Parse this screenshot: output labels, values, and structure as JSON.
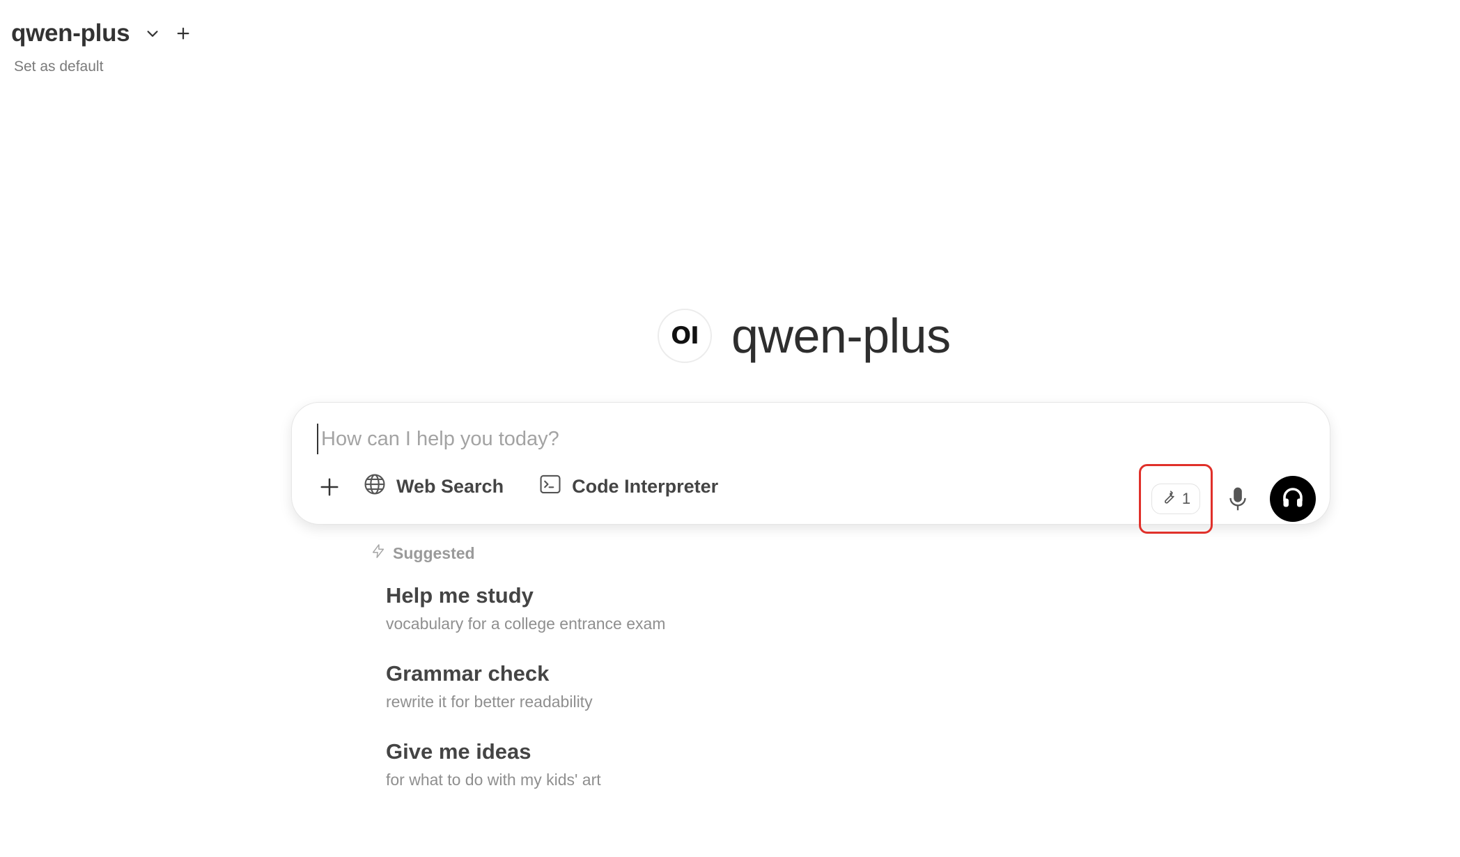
{
  "header": {
    "model_name": "qwen-plus",
    "set_default_label": "Set as default"
  },
  "hero": {
    "logo_text": "OI",
    "title": "qwen-plus"
  },
  "chat": {
    "placeholder": "How can I help you today?",
    "web_search_label": "Web Search",
    "code_interpreter_label": "Code Interpreter",
    "tools_count": "1"
  },
  "suggestions": {
    "heading": "Suggested",
    "items": [
      {
        "title": "Help me study",
        "subtitle": "vocabulary for a college entrance exam"
      },
      {
        "title": "Grammar check",
        "subtitle": "rewrite it for better readability"
      },
      {
        "title": "Give me ideas",
        "subtitle": "for what to do with my kids' art"
      }
    ]
  },
  "colors": {
    "highlight": "#e0302a",
    "voice_button": "#000000"
  }
}
